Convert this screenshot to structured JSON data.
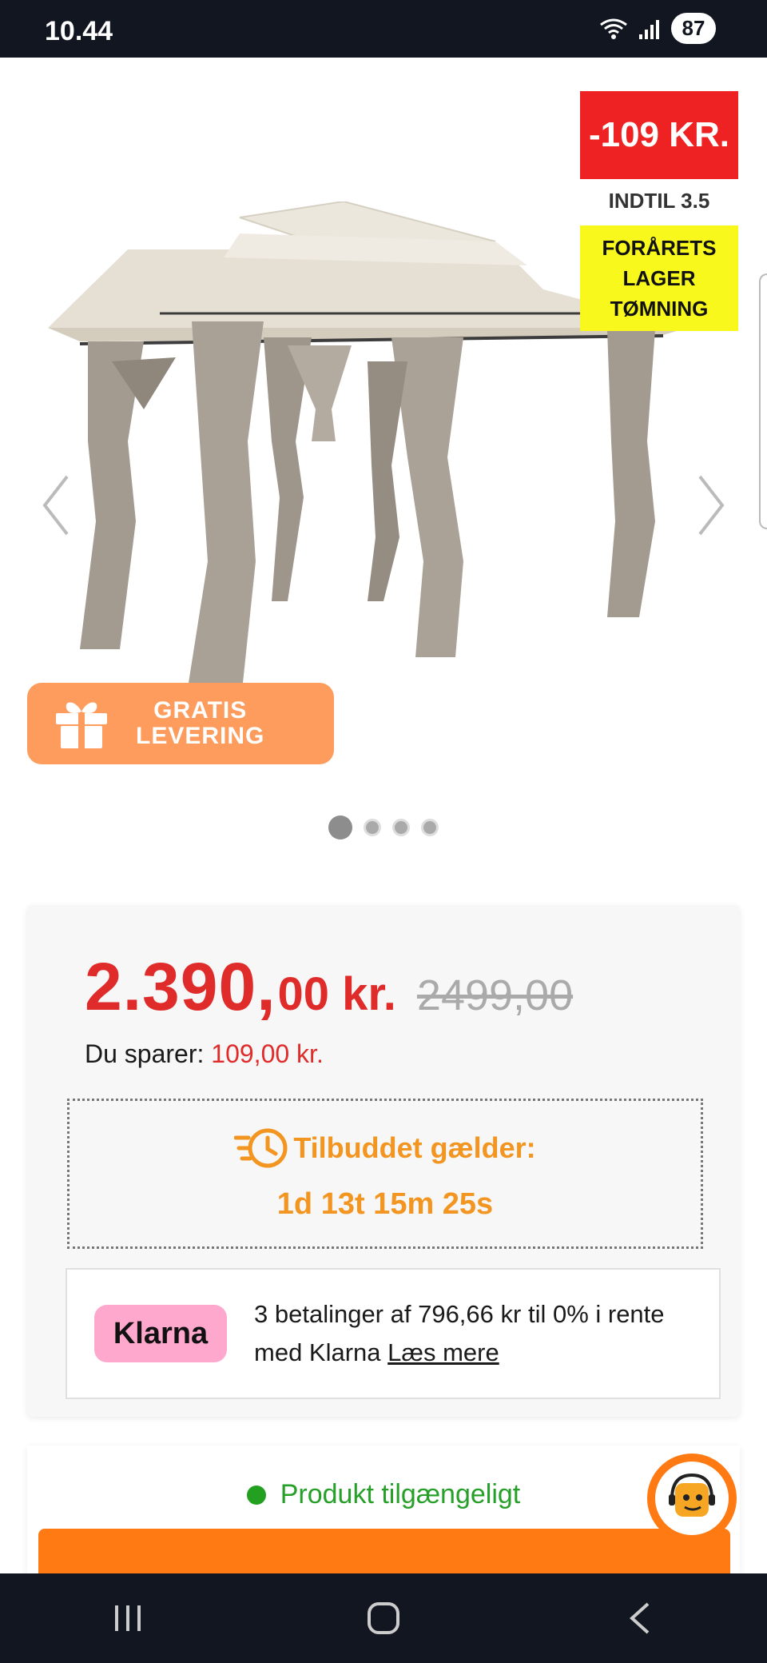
{
  "status_bar": {
    "time": "10.44",
    "battery": "87"
  },
  "product": {
    "discount_badge": "-109 KR.",
    "up_to": "INDTIL 3.5",
    "promo_lines": [
      "FORÅRETS",
      "LAGER",
      "TØMNING"
    ],
    "free_delivery_lines": [
      "GRATIS",
      "LEVERING"
    ],
    "image_count": 4,
    "active_image": 1
  },
  "price": {
    "main": "2.390,",
    "cents": "00 kr.",
    "old": "2499,00",
    "savings_label": "Du sparer:",
    "savings_amount": "109,00 kr."
  },
  "offer": {
    "title": "Tilbuddet gælder:",
    "countdown": "1d 13t 15m 25s"
  },
  "klarna": {
    "logo": "Klarna",
    "text_line1": "3 betalinger af 796,66 kr til 0% i rente",
    "text_line2": "med Klarna",
    "link": "Læs mere"
  },
  "availability": {
    "text": "Produkt tilgængeligt"
  },
  "colors": {
    "accent_orange": "#ff7a12",
    "price_red": "#e02b2b",
    "offer_orange": "#f39521",
    "available_green": "#23a01f",
    "klarna_pink": "#ffa8cd",
    "promo_yellow": "#f8f81c"
  },
  "icons": {
    "gift": "gift-icon",
    "timer": "timer-icon",
    "support": "support-agent-icon",
    "prev": "chevron-left-icon",
    "next": "chevron-right-icon"
  }
}
